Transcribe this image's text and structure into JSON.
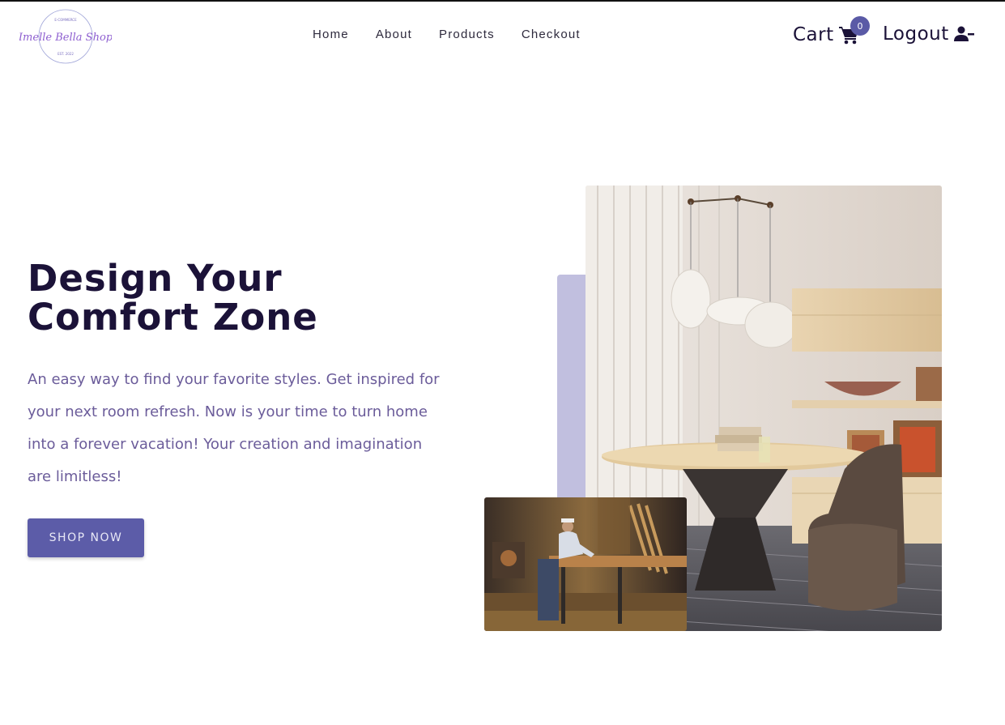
{
  "header": {
    "logo": {
      "name": "Imelle Bella Shop",
      "top_text": "E-COMMERCE",
      "bottom_text": "EST. 2022"
    },
    "nav": [
      {
        "label": "Home"
      },
      {
        "label": "About"
      },
      {
        "label": "Products"
      },
      {
        "label": "Checkout"
      }
    ],
    "cart": {
      "label": "Cart",
      "count": "0",
      "icon": "cart-icon"
    },
    "logout": {
      "label": "Logout",
      "icon": "user-minus-icon"
    }
  },
  "hero": {
    "title_line1": "Design Your",
    "title_line2": "Comfort Zone",
    "description": "An easy way to find your favorite styles. Get inspired for your next room refresh. Now is your time to turn home into a forever vacation! Your creation and imagination are limitless!",
    "cta_label": "SHOP NOW"
  },
  "colors": {
    "accent": "#5c5ca8",
    "title": "#1b1238",
    "text": "#6b5c9a",
    "accent_block": "#c1bfdf"
  }
}
